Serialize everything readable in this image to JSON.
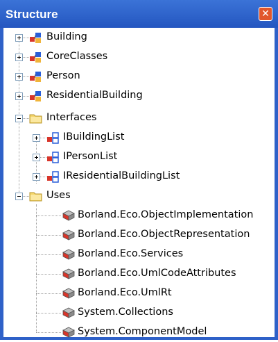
{
  "panel": {
    "title": "Structure",
    "close_glyph": "✕"
  },
  "tree": {
    "classes": [
      {
        "label": "Building",
        "icon": "class-icon"
      },
      {
        "label": "CoreClasses",
        "icon": "class-icon"
      },
      {
        "label": "Person",
        "icon": "class-icon"
      },
      {
        "label": "ResidentialBuilding",
        "icon": "class-icon"
      }
    ],
    "interfaces": {
      "label": "Interfaces",
      "icon": "folder-open-icon",
      "children": [
        {
          "label": "IBuildingList",
          "icon": "interface-icon"
        },
        {
          "label": "IPersonList",
          "icon": "interface-icon"
        },
        {
          "label": "IResidentialBuildingList",
          "icon": "interface-icon"
        }
      ]
    },
    "uses": {
      "label": "Uses",
      "icon": "folder-open-icon",
      "children": [
        {
          "label": "Borland.Eco.ObjectImplementation",
          "icon": "namespace-icon"
        },
        {
          "label": "Borland.Eco.ObjectRepresentation",
          "icon": "namespace-icon"
        },
        {
          "label": "Borland.Eco.Services",
          "icon": "namespace-icon"
        },
        {
          "label": "Borland.Eco.UmlCodeAttributes",
          "icon": "namespace-icon"
        },
        {
          "label": "Borland.Eco.UmlRt",
          "icon": "namespace-icon"
        },
        {
          "label": "System.Collections",
          "icon": "namespace-icon"
        },
        {
          "label": "System.ComponentModel",
          "icon": "namespace-icon"
        }
      ]
    }
  },
  "colors": {
    "titlebar": "#2f61c8",
    "close_button": "#e1572d",
    "folder": "#f5d66b",
    "class_red": "#d8352a",
    "class_blue": "#2a5fd8"
  }
}
